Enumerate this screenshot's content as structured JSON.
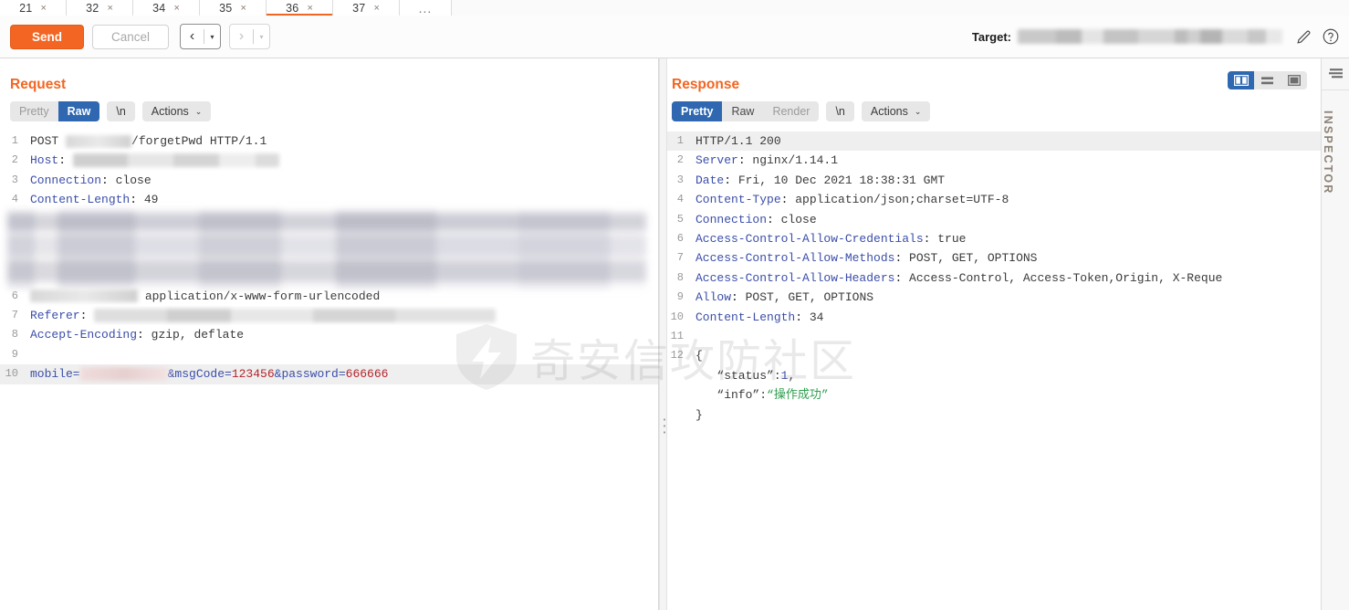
{
  "tabs": {
    "items": [
      {
        "label": "21",
        "close": "×",
        "active": false
      },
      {
        "label": "32",
        "close": "×",
        "active": false
      },
      {
        "label": "34",
        "close": "×",
        "active": false
      },
      {
        "label": "35",
        "close": "×",
        "active": false
      },
      {
        "label": "36",
        "close": "×",
        "active": true
      },
      {
        "label": "37",
        "close": "×",
        "active": false
      }
    ],
    "overflow_label": "..."
  },
  "toolbar": {
    "send_label": "Send",
    "cancel_label": "Cancel",
    "prev_arrow": "‹",
    "prev_caret": "▾",
    "next_arrow": "›",
    "next_caret": "▾",
    "target_label": "Target:",
    "target_value": "",
    "edit_icon": "pencil-icon",
    "help_icon": "question-circle-icon"
  },
  "request": {
    "title": "Request",
    "tabs": {
      "pretty": "Pretty",
      "raw": "Raw",
      "newline": "\\n",
      "actions": "Actions",
      "caret": "⌄"
    },
    "active_tab": "Raw",
    "lines": [
      {
        "n": "1",
        "type": "request-line",
        "method": "POST",
        "redacted": true,
        "path": "/forgetPwd",
        "version": "HTTP/1.1"
      },
      {
        "n": "2",
        "type": "header",
        "key": "Host",
        "value": "",
        "redacted": true
      },
      {
        "n": "3",
        "type": "header",
        "key": "Connection",
        "value": "close"
      },
      {
        "n": "4",
        "type": "header",
        "key": "Content-Length",
        "value": "49"
      },
      {
        "n": "5",
        "type": "header-blurred",
        "key": "User-Agent",
        "value": ""
      },
      {
        "n": "6",
        "type": "header",
        "key": "Content-Type",
        "value": "application/x-www-form-urlencoded",
        "key_redacted": true
      },
      {
        "n": "7",
        "type": "header",
        "key": "Referer",
        "value": "",
        "redacted": true
      },
      {
        "n": "8",
        "type": "header",
        "key": "Accept-Encoding",
        "value": "gzip, deflate"
      },
      {
        "n": "9",
        "type": "blank",
        "value": ""
      },
      {
        "n": "10",
        "type": "body",
        "param1": "mobile=",
        "param2": "&msgCode=",
        "val2": "123456",
        "param3": "&password=",
        "val3": "666666"
      }
    ]
  },
  "response": {
    "title": "Response",
    "tabs": {
      "pretty": "Pretty",
      "raw": "Raw",
      "render": "Render",
      "newline": "\\n",
      "actions": "Actions",
      "caret": "⌄"
    },
    "active_tab": "Pretty",
    "view_modes": [
      {
        "name": "split-vertical",
        "active": true
      },
      {
        "name": "split-horizontal",
        "active": false
      },
      {
        "name": "maximize",
        "active": false
      }
    ],
    "lines": [
      {
        "n": "1",
        "key": "HTTP/1.1",
        "value": " 200",
        "status_line": true
      },
      {
        "n": "2",
        "key": "Server",
        "value": "nginx/1.14.1"
      },
      {
        "n": "3",
        "key": "Date",
        "value": "Fri, 10 Dec 2021 18:38:31 GMT"
      },
      {
        "n": "4",
        "key": "Content-Type",
        "value": "application/json;charset=UTF-8"
      },
      {
        "n": "5",
        "key": "Connection",
        "value": "close"
      },
      {
        "n": "6",
        "key": "Access-Control-Allow-Credentials",
        "value": "true"
      },
      {
        "n": "7",
        "key": "Access-Control-Allow-Methods",
        "value": "POST, GET, OPTIONS"
      },
      {
        "n": "8",
        "key": "Access-Control-Allow-Headers",
        "value": "Access-Control, Access-Token,Origin, X-Reque"
      },
      {
        "n": "9",
        "key": "Allow",
        "value": "POST, GET, OPTIONS"
      },
      {
        "n": "10",
        "key": "Content-Length",
        "value": "34"
      },
      {
        "n": "11",
        "key": "",
        "value": ""
      },
      {
        "n": "12",
        "key": "",
        "value": "{"
      }
    ],
    "body": {
      "status_key": "“status”",
      "status_sep": ":",
      "status_val": "1",
      "status_comma": ",",
      "info_key": "“info”",
      "info_sep": ":",
      "info_val": "“操作成功”",
      "close_brace": "}"
    }
  },
  "inspector": {
    "label": "INSPECTOR",
    "menu_icon": "list-lines-icon"
  },
  "watermark": {
    "text": "奇安信攻防社区",
    "logo": "shield-bolt-icon"
  },
  "colors": {
    "accent_orange": "#f26522",
    "accent_blue": "#2f68b0",
    "header_key": "#3b4ea8",
    "string_green": "#2e9e4f",
    "number_red": "#b4232a"
  }
}
